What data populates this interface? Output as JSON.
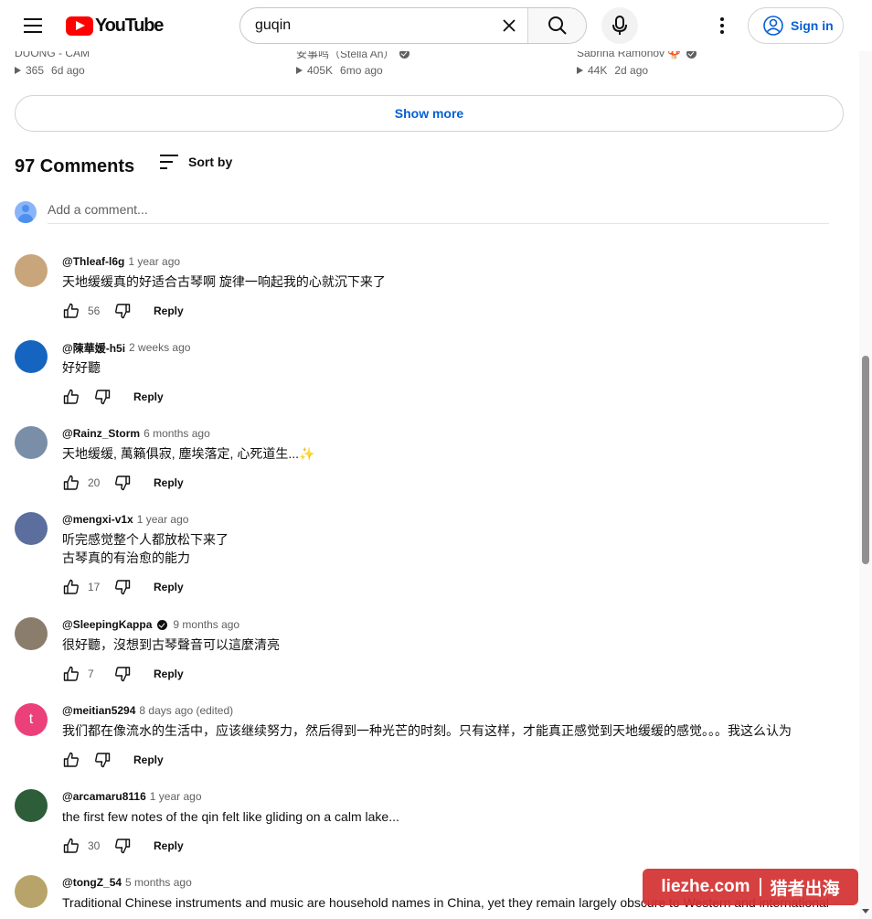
{
  "header": {
    "logo_text": "YouTube",
    "search_value": "guqin",
    "sign_in_label": "Sign in"
  },
  "related": [
    {
      "channel": "DUONG - CAM",
      "views": "365",
      "age": "6d ago",
      "verified": false
    },
    {
      "channel": "安事鸣（Stella An）",
      "views": "405K",
      "age": "6mo ago",
      "verified": true
    },
    {
      "channel": "Sabrina Ramonov 🍄",
      "views": "44K",
      "age": "2d ago",
      "verified": true
    }
  ],
  "show_more_label": "Show more",
  "comments_header": {
    "count_label": "97 Comments",
    "sort_label": "Sort by",
    "add_placeholder": "Add a comment..."
  },
  "reply_label": "Reply",
  "comments": [
    {
      "author": "@Thleaf-l6g",
      "time": "1 year ago",
      "text": "天地缓缓真的好适合古琴啊 旋律一响起我的心就沉下来了",
      "likes": "56",
      "verified": false,
      "avatar_color": "#c9a57c"
    },
    {
      "author": "@陳華媛-h5i",
      "time": "2 weeks ago",
      "text": "好好聽",
      "likes": "",
      "verified": false,
      "avatar_color": "#1565c0"
    },
    {
      "author": "@Rainz_Storm",
      "time": "6 months ago",
      "text": "天地缓缓, 萬籟俱寂, 塵埃落定, 心死道生...✨",
      "likes": "20",
      "verified": false,
      "avatar_color": "#7a8ea8"
    },
    {
      "author": "@mengxi-v1x",
      "time": "1 year ago",
      "text": "听完感觉整个人都放松下来了\n古琴真的有治愈的能力",
      "likes": "17",
      "verified": false,
      "avatar_color": "#5b6e9e"
    },
    {
      "author": "@SleepingKappa",
      "time": "9 months ago",
      "text": "很好聽，沒想到古琴聲音可以這麼清亮",
      "likes": "7",
      "verified": true,
      "avatar_color": "#8b7d6b"
    },
    {
      "author": "@meitian5294",
      "time": "8 days ago (edited)",
      "text": "我们都在像流水的生活中，应该继续努力，然后得到一种光芒的时刻。只有这样，才能真正感觉到天地缓缓的感觉。。。我这么认为",
      "likes": "",
      "verified": false,
      "avatar_color": "#ec407a",
      "avatar_letter": "t"
    },
    {
      "author": "@arcamaru8116",
      "time": "1 year ago",
      "text": "the first few notes of the qin felt like gliding on a calm lake...",
      "likes": "30",
      "verified": false,
      "avatar_color": "#2e5d3a"
    },
    {
      "author": "@tongZ_54",
      "time": "5 months ago",
      "text": "Traditional Chinese instruments and music are household names in China, yet they remain largely obscure to Western and international",
      "likes": "",
      "verified": false,
      "avatar_color": "#b8a46a"
    }
  ],
  "watermark": {
    "left": "liezhe.com",
    "right": "猎者出海"
  }
}
